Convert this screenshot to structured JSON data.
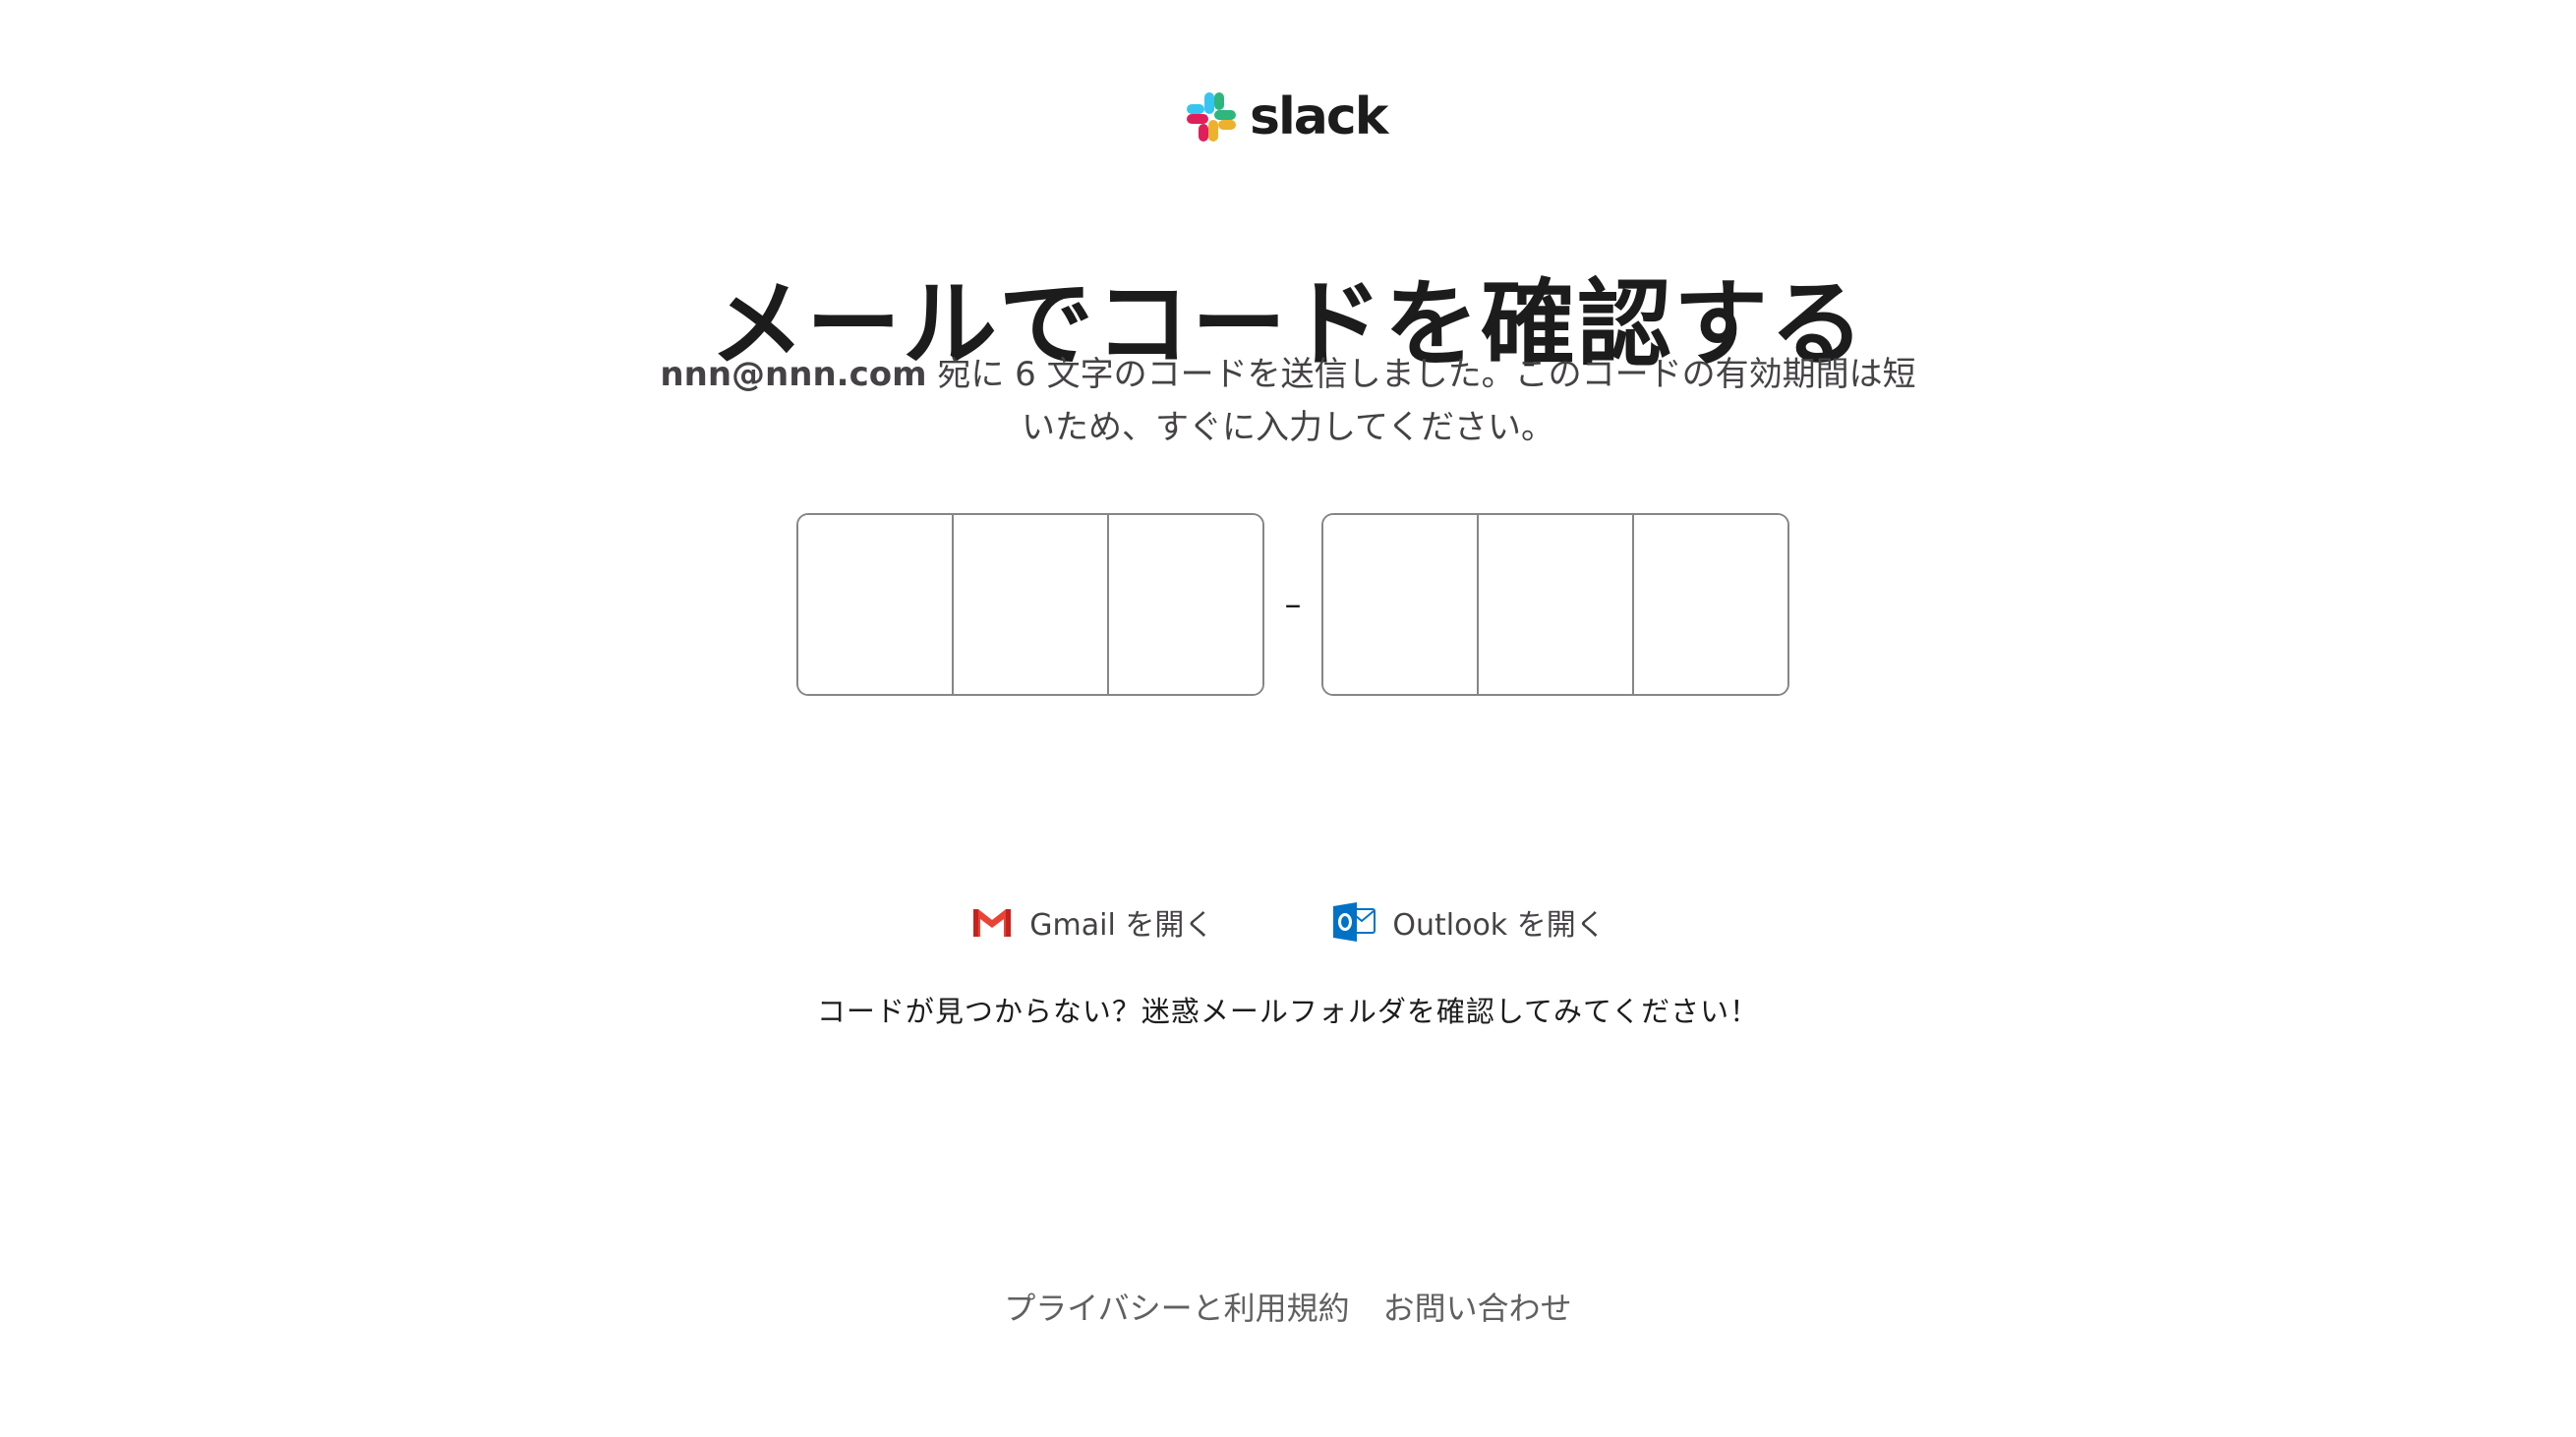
{
  "brand": {
    "logo_text": "slack",
    "logo_icon": "slack-logo-icon",
    "colors": {
      "blue": "#36C5F0",
      "green": "#2EB67D",
      "yellow": "#ECB22E",
      "red": "#E01E5A"
    }
  },
  "main": {
    "title": "メールでコードを確認する",
    "email": "nnn@nnn.com",
    "description": " 宛に 6 文字のコードを送信しました。このコードの有効期間は短いため、すぐに入力してください。",
    "code_separator": "–",
    "code_inputs": [
      "",
      "",
      "",
      "",
      "",
      ""
    ]
  },
  "mail_links": {
    "gmail": {
      "label": "Gmail を開く",
      "icon": "gmail-icon",
      "color": "#EA4335"
    },
    "outlook": {
      "label": "Outlook を開く",
      "icon": "outlook-icon",
      "color": "#0072C6"
    }
  },
  "hint": "コードが見つからない？迷惑メールフォルダを確認してみてください！",
  "footer": {
    "privacy": "プライバシーと利用規約",
    "contact": "お問い合わせ"
  }
}
